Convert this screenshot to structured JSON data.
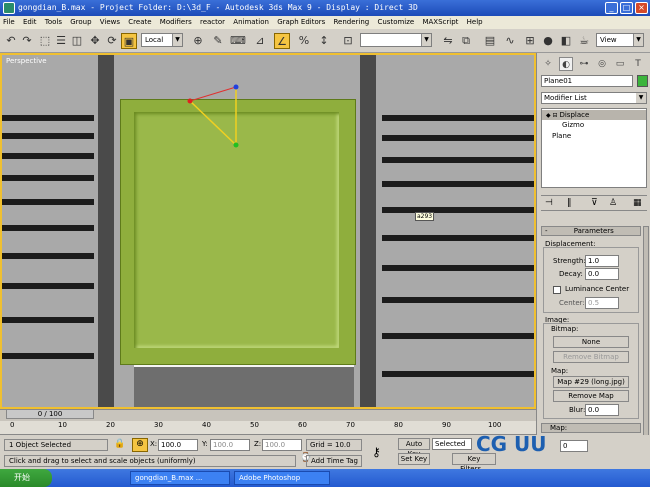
{
  "window": {
    "title": "gongdian_B.max    - Project Folder: D:\\3d_F    - Autodesk 3ds Max 9    - Display : Direct 3D",
    "minimize": "_",
    "maximize": "□",
    "close": "×"
  },
  "menu": [
    "File",
    "Edit",
    "Tools",
    "Group",
    "Views",
    "Create",
    "Modifiers",
    "reactor",
    "Animation",
    "Graph Editors",
    "Rendering",
    "Customize",
    "MAXScript",
    "Help"
  ],
  "toolbar": {
    "coord_system": "Local",
    "view_dropdown": "View",
    "icons": [
      "undo-icon",
      "redo-icon",
      "link-icon",
      "unlink-icon",
      "bind-icon",
      "select-icon",
      "select-region-icon",
      "select-by-name-icon",
      "window-crossing-icon",
      "move-icon",
      "rotate-icon",
      "scale-icon"
    ]
  },
  "viewport": {
    "label": "Perspective",
    "marker": "a293",
    "slab_color": "#8fae3d"
  },
  "command_panel": {
    "object_name": "Plane01",
    "object_color": "#3cb43c",
    "modifier_list": "Modifier List",
    "stack": [
      "Displace",
      "Gizmo",
      "Plane"
    ],
    "parameters_title": "Parameters",
    "displacement_label": "Displacement:",
    "strength_label": "Strength:",
    "strength_value": "1.0",
    "decay_label": "Decay:",
    "decay_value": "0.0",
    "luminance_center": "Luminance Center",
    "center_label": "Center:",
    "center_value": "0.5",
    "image_label": "Image:",
    "bitmap_label": "Bitmap:",
    "none_button": "None",
    "remove_bitmap": "Remove Bitmap",
    "map_label": "Map:",
    "map_button": "Map #29 (long.jpg)",
    "remove_map": "Remove Map",
    "blur_label": "Blur:",
    "blur_value": "0.0",
    "map_rollout": "Map:"
  },
  "timeline": {
    "slider": "0 / 100",
    "ticks": [
      "0",
      "10",
      "20",
      "30",
      "40",
      "50",
      "60",
      "70",
      "80",
      "90",
      "100"
    ]
  },
  "status": {
    "selection": "1 Object Selected",
    "hint": "Click and drag to select and scale objects (uniformly)",
    "x_label": "X:",
    "x_value": "100.0",
    "y_label": "Y:",
    "y_value": "100.0",
    "z_label": "Z:",
    "z_value": "100.0",
    "grid": "Grid = 10.0",
    "add_time_tag": "Add Time Tag",
    "auto_key": "Auto Key",
    "selected": "Selected",
    "set_key": "Set Key",
    "key_filters": "Key Filters...",
    "frame": "0"
  },
  "taskbar": {
    "start": "开始",
    "tasks": [
      "gongdian_B.max ...",
      "Adobe Photoshop"
    ]
  },
  "watermark": "CG UU"
}
